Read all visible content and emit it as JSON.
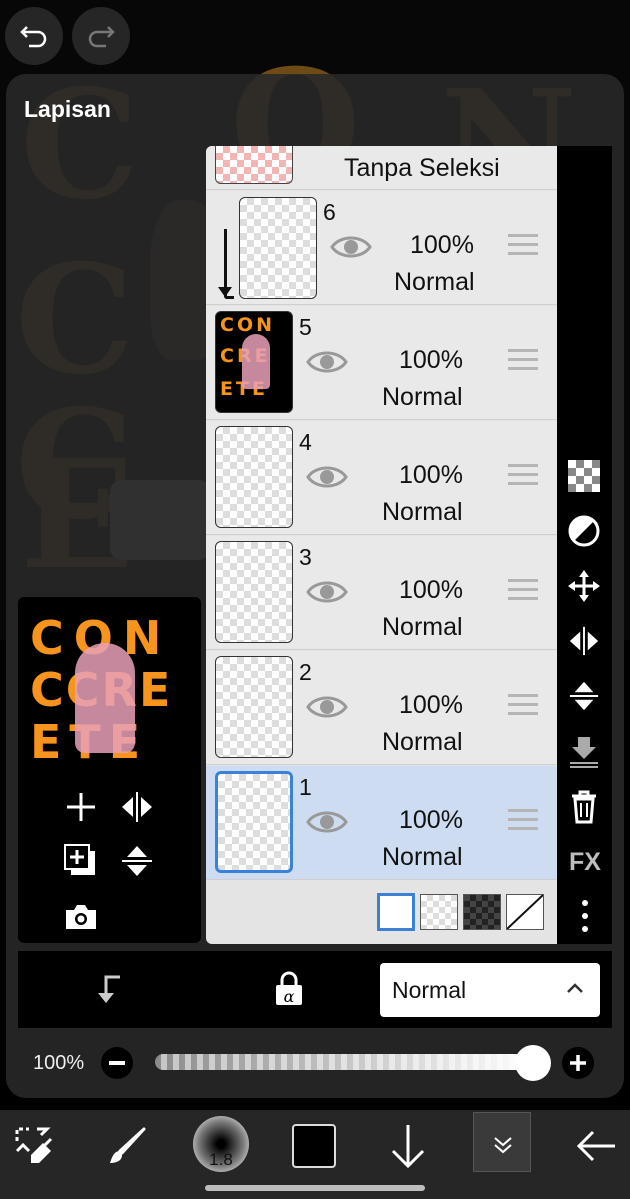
{
  "panel": {
    "title": "Lapisan"
  },
  "layers": {
    "selection_row_label": "Tanpa Seleksi",
    "items": [
      {
        "number": "6",
        "opacity": "100%",
        "blend": "Normal"
      },
      {
        "number": "5",
        "opacity": "100%",
        "blend": "Normal"
      },
      {
        "number": "4",
        "opacity": "100%",
        "blend": "Normal"
      },
      {
        "number": "3",
        "opacity": "100%",
        "blend": "Normal"
      },
      {
        "number": "2",
        "opacity": "100%",
        "blend": "Normal"
      },
      {
        "number": "1",
        "opacity": "100%",
        "blend": "Normal"
      }
    ]
  },
  "canvas_art": {
    "letters": [
      "C",
      "O",
      "N",
      "C",
      "C",
      "E"
    ]
  },
  "preview_art": {
    "lines": [
      "CON",
      "CCRE",
      "ETE"
    ]
  },
  "layer5_thumb": {
    "lines": [
      "CON",
      "CRE",
      "ETE"
    ]
  },
  "blend_select": {
    "value": "Normal"
  },
  "opacity": {
    "label": "100%",
    "value": 1.0
  },
  "right_tools": {
    "fx_label": "FX"
  },
  "brush": {
    "size": "1.8"
  },
  "colors": {
    "accent": "#3a82d8",
    "canvas_letter": "#6e4a14",
    "preview_letter": "#f7941d",
    "selected_row": "#cddcf0",
    "foreground": "#000000"
  }
}
